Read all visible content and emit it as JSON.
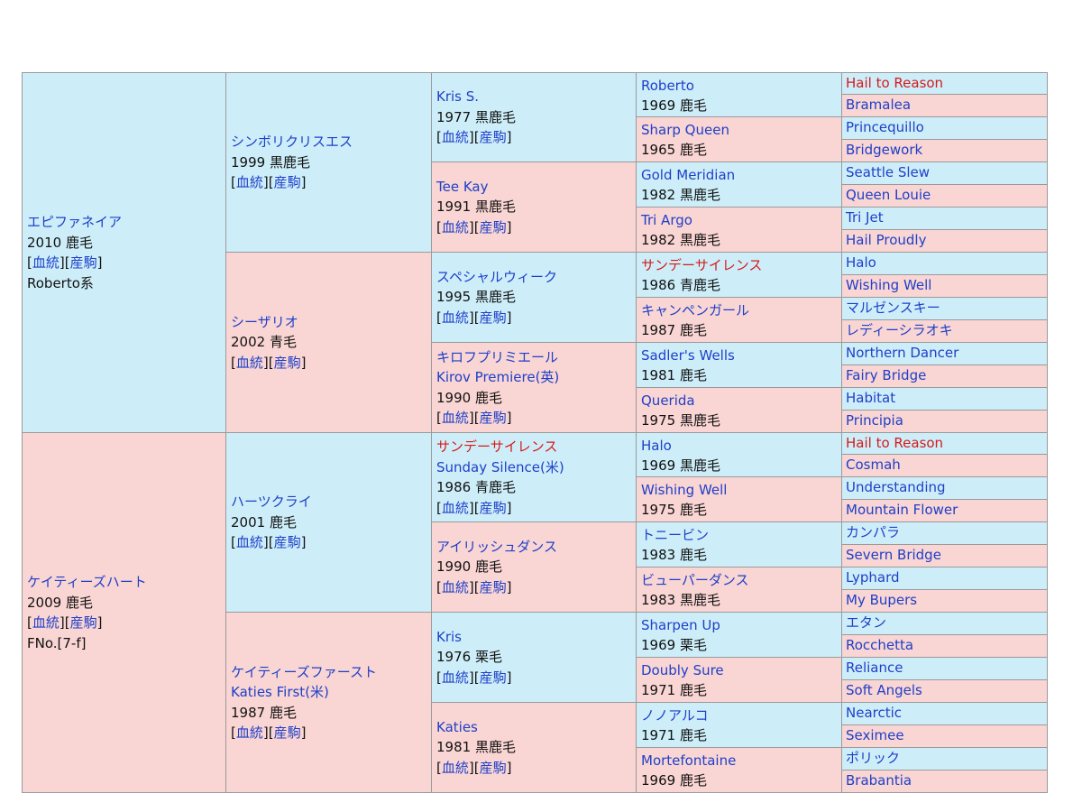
{
  "pedigree": {
    "gen1": [
      {
        "name": "エピファネイア",
        "year": "2010 鹿毛",
        "link1": "血統",
        "link2": "産駒",
        "extra": "Roberto系",
        "bg": "blue"
      },
      {
        "name": "ケイティーズハート",
        "year": "2009 鹿毛",
        "link1": "血統",
        "link2": "産駒",
        "extra": "FNo.[7-f]",
        "bg": "pink"
      }
    ],
    "gen2": [
      {
        "name": "シンボリクリスエス",
        "year": "1999 黒鹿毛",
        "link1": "血統",
        "link2": "産駒",
        "bg": "blue"
      },
      {
        "name": "シーザリオ",
        "year": "2002 青毛",
        "link1": "血統",
        "link2": "産駒",
        "bg": "pink"
      },
      {
        "name": "ハーツクライ",
        "year": "2001 鹿毛",
        "link1": "血統",
        "link2": "産駒",
        "bg": "blue"
      },
      {
        "name": "ケイティーズファースト",
        "alt": "Katies First(米)",
        "year": "1987 鹿毛",
        "link1": "血統",
        "link2": "産駒",
        "bg": "pink"
      }
    ],
    "gen3": [
      {
        "name": "Kris S.",
        "year": "1977 黒鹿毛",
        "link1": "血統",
        "link2": "産駒",
        "bg": "blue",
        "red": false
      },
      {
        "name": "Tee Kay",
        "year": "1991 黒鹿毛",
        "link1": "血統",
        "link2": "産駒",
        "bg": "pink",
        "red": false
      },
      {
        "name": "スペシャルウィーク",
        "year": "1995 黒鹿毛",
        "link1": "血統",
        "link2": "産駒",
        "bg": "blue",
        "red": false
      },
      {
        "name": "キロフプリミエール",
        "alt": "Kirov Premiere(英)",
        "year": "1990 鹿毛",
        "link1": "血統",
        "link2": "産駒",
        "bg": "pink",
        "red": false
      },
      {
        "name": "サンデーサイレンス",
        "alt": "Sunday Silence(米)",
        "year": "1986 青鹿毛",
        "link1": "血統",
        "link2": "産駒",
        "bg": "blue",
        "red": true
      },
      {
        "name": "アイリッシュダンス",
        "year": "1990 鹿毛",
        "link1": "血統",
        "link2": "産駒",
        "bg": "pink",
        "red": false
      },
      {
        "name": "Kris",
        "year": "1976 栗毛",
        "link1": "血統",
        "link2": "産駒",
        "bg": "blue",
        "red": false
      },
      {
        "name": "Katies",
        "year": "1981 黒鹿毛",
        "link1": "血統",
        "link2": "産駒",
        "bg": "pink",
        "red": false
      }
    ],
    "gen4": [
      {
        "name": "Roberto",
        "year": "1969 鹿毛",
        "bg": "blue",
        "red": false
      },
      {
        "name": "Sharp Queen",
        "year": "1965 鹿毛",
        "bg": "pink",
        "red": false
      },
      {
        "name": "Gold Meridian",
        "year": "1982 黒鹿毛",
        "bg": "blue",
        "red": false
      },
      {
        "name": "Tri Argo",
        "year": "1982 黒鹿毛",
        "bg": "pink",
        "red": false
      },
      {
        "name": "サンデーサイレンス",
        "year": "1986 青鹿毛",
        "bg": "blue",
        "red": true
      },
      {
        "name": "キャンペンガール",
        "year": "1987 鹿毛",
        "bg": "pink",
        "red": false
      },
      {
        "name": "Sadler's Wells",
        "year": "1981 鹿毛",
        "bg": "blue",
        "red": false
      },
      {
        "name": "Querida",
        "year": "1975 黒鹿毛",
        "bg": "pink",
        "red": false
      },
      {
        "name": "Halo",
        "year": "1969 黒鹿毛",
        "bg": "blue",
        "red": false
      },
      {
        "name": "Wishing Well",
        "year": "1975 鹿毛",
        "bg": "pink",
        "red": false
      },
      {
        "name": "トニービン",
        "year": "1983 鹿毛",
        "bg": "blue",
        "red": false
      },
      {
        "name": "ビューパーダンス",
        "year": "1983 黒鹿毛",
        "bg": "pink",
        "red": false
      },
      {
        "name": "Sharpen Up",
        "year": "1969 栗毛",
        "bg": "blue",
        "red": false
      },
      {
        "name": "Doubly Sure",
        "year": "1971 鹿毛",
        "bg": "pink",
        "red": false
      },
      {
        "name": "ノノアルコ",
        "year": "1971 鹿毛",
        "bg": "blue",
        "red": false
      },
      {
        "name": "Mortefontaine",
        "year": "1969 鹿毛",
        "bg": "pink",
        "red": false
      }
    ],
    "gen5": [
      {
        "name": "Hail to Reason",
        "bg": "blue",
        "red": true
      },
      {
        "name": "Bramalea",
        "bg": "pink",
        "red": false
      },
      {
        "name": "Princequillo",
        "bg": "blue",
        "red": false
      },
      {
        "name": "Bridgework",
        "bg": "pink",
        "red": false
      },
      {
        "name": "Seattle Slew",
        "bg": "blue",
        "red": false
      },
      {
        "name": "Queen Louie",
        "bg": "pink",
        "red": false
      },
      {
        "name": "Tri Jet",
        "bg": "blue",
        "red": false
      },
      {
        "name": "Hail Proudly",
        "bg": "pink",
        "red": false
      },
      {
        "name": "Halo",
        "bg": "blue",
        "red": false
      },
      {
        "name": "Wishing Well",
        "bg": "pink",
        "red": false
      },
      {
        "name": "マルゼンスキー",
        "bg": "blue",
        "red": false
      },
      {
        "name": "レディーシラオキ",
        "bg": "pink",
        "red": false
      },
      {
        "name": "Northern Dancer",
        "bg": "blue",
        "red": false
      },
      {
        "name": "Fairy Bridge",
        "bg": "pink",
        "red": false
      },
      {
        "name": "Habitat",
        "bg": "blue",
        "red": false
      },
      {
        "name": "Principia",
        "bg": "pink",
        "red": false
      },
      {
        "name": "Hail to Reason",
        "bg": "blue",
        "red": true
      },
      {
        "name": "Cosmah",
        "bg": "pink",
        "red": false
      },
      {
        "name": "Understanding",
        "bg": "blue",
        "red": false
      },
      {
        "name": "Mountain Flower",
        "bg": "pink",
        "red": false
      },
      {
        "name": "カンパラ",
        "bg": "blue",
        "red": false
      },
      {
        "name": "Severn Bridge",
        "bg": "pink",
        "red": false
      },
      {
        "name": "Lyphard",
        "bg": "blue",
        "red": false
      },
      {
        "name": "My Bupers",
        "bg": "pink",
        "red": false
      },
      {
        "name": "エタン",
        "bg": "blue",
        "red": false
      },
      {
        "name": "Rocchetta",
        "bg": "pink",
        "red": false
      },
      {
        "name": "Reliance",
        "bg": "blue",
        "red": false
      },
      {
        "name": "Soft Angels",
        "bg": "pink",
        "red": false
      },
      {
        "name": "Nearctic",
        "bg": "blue",
        "red": false
      },
      {
        "name": "Seximee",
        "bg": "pink",
        "red": false
      },
      {
        "name": "ポリック",
        "bg": "blue",
        "red": false
      },
      {
        "name": "Brabantia",
        "bg": "pink",
        "red": false
      }
    ]
  },
  "colors": {
    "blue_cell": "#cdeef9",
    "pink_cell": "#f9d5d3",
    "link": "#1f40c8",
    "highlight": "#d61a1a",
    "border": "#9a9a9a"
  }
}
